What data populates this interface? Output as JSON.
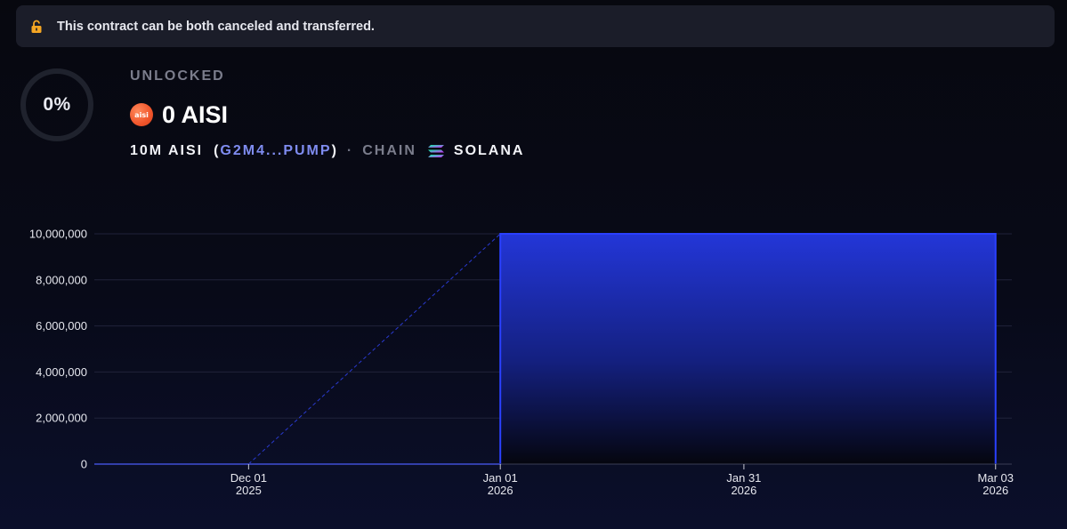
{
  "banner": {
    "icon": "lock-open-icon",
    "text": "This contract can be both canceled and transferred."
  },
  "progress": {
    "percent_label": "0%",
    "fraction": 0
  },
  "unlocked": {
    "label": "UNLOCKED",
    "amount": "0 AISI",
    "token_logo_text": "aisi"
  },
  "meta": {
    "total": "10M AISI",
    "paren_open": "(",
    "address": "G2M4...PUMP",
    "paren_close": ")",
    "dot": "·",
    "chain_label": "CHAIN",
    "chain_icon": "solana-icon",
    "chain_name": "SOLANA"
  },
  "colors": {
    "accent": "#2a40ff",
    "address": "#7f8cf0",
    "logo": "#f0552b"
  },
  "chart_data": {
    "type": "area",
    "ylim": [
      0,
      10000000
    ],
    "yticks": [
      0,
      2000000,
      4000000,
      6000000,
      8000000,
      10000000
    ],
    "ytick_labels": [
      "0",
      "2,000,000",
      "4,000,000",
      "6,000,000",
      "8,000,000",
      "10,000,000"
    ],
    "xlim": [
      "2025-11-12",
      "2026-03-05"
    ],
    "xticks": [
      {
        "date": "2025-12-01",
        "line1": "Dec 01",
        "line2": "2025"
      },
      {
        "date": "2026-01-01",
        "line1": "Jan 01",
        "line2": "2026"
      },
      {
        "date": "2026-01-31",
        "line1": "Jan 31",
        "line2": "2026"
      },
      {
        "date": "2026-03-03",
        "line1": "Mar 03",
        "line2": "2026"
      }
    ],
    "series": [
      {
        "style": "step-area",
        "points": [
          {
            "x": "2025-11-12",
            "y": 0
          },
          {
            "x": "2026-01-01",
            "y": 0
          },
          {
            "x": "2026-01-01",
            "y": 10000000
          },
          {
            "x": "2026-03-03",
            "y": 10000000
          },
          {
            "x": "2026-03-03",
            "y": 0
          }
        ]
      },
      {
        "style": "dashed-line",
        "points": [
          {
            "x": "2025-12-01",
            "y": 0
          },
          {
            "x": "2026-01-01",
            "y": 10000000
          }
        ]
      }
    ],
    "grid": true
  }
}
